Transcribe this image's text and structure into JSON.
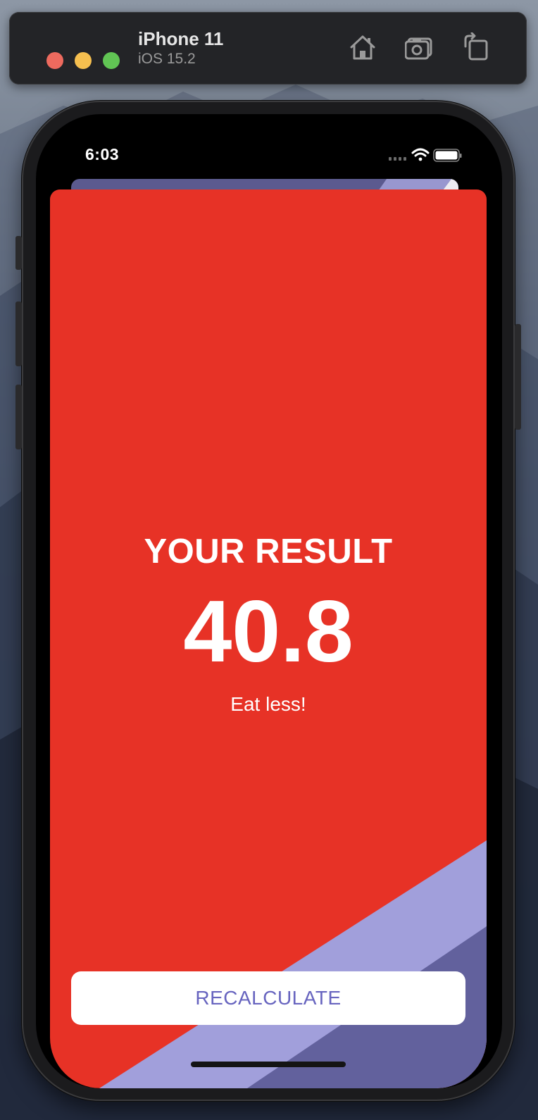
{
  "simulator": {
    "device_name": "iPhone 11",
    "os_version": "iOS 15.2",
    "toolbar_icons": [
      "home-icon",
      "screenshot-icon",
      "rotate-icon"
    ]
  },
  "status_bar": {
    "time": "6:03",
    "icons": [
      "signal-icon",
      "wifi-icon",
      "battery-icon"
    ]
  },
  "result": {
    "title": "YOUR RESULT",
    "value": "40.8",
    "advice": "Eat less!"
  },
  "actions": {
    "recalculate_label": "RECALCULATE"
  },
  "colors": {
    "card_background": "#e73226",
    "stripe_light": "#a19fdb",
    "stripe_dark": "#62619d",
    "button_text": "#6764bf"
  }
}
